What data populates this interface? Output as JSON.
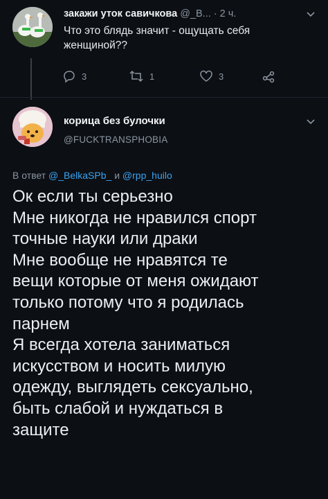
{
  "quoted_tweet": {
    "name": "закажи уток савичкова",
    "handle": "@_В...",
    "separator": "·",
    "time": "2 ч.",
    "text": "Что это блядь значит - ощущать себя женщиной??",
    "reply_count": "3",
    "retweet_count": "1",
    "like_count": "3"
  },
  "main_tweet": {
    "name": "корица без булочки",
    "handle": "@FUCKTRANSPHOBIA",
    "reply_prefix": "В ответ",
    "reply_to_1": "@_BelkaSPb_",
    "reply_joiner": "и",
    "reply_to_2": "@rpp_huilo",
    "lines": [
      "Ок если ты серьезно",
      "Мне никогда не нравился спорт",
      "точные науки или драки",
      "Мне вообще не нравятся те",
      "вещи которые от меня ожидают",
      "только потому что я родилась",
      "парнем",
      "Я всегда хотела заниматься",
      "искусством и носить милую",
      "одежду, выглядеть сексуально,",
      "быть слабой и нуждаться в",
      "защите"
    ]
  },
  "colors": {
    "background": "#0c0f14",
    "text": "#e9ecef",
    "muted": "#8b96a1",
    "link": "#3aa3f0"
  },
  "icons": [
    "avatar-geese",
    "avatar-winnie-pooh",
    "chevron-down-icon",
    "reply-icon",
    "retweet-icon",
    "like-icon",
    "share-icon"
  ]
}
